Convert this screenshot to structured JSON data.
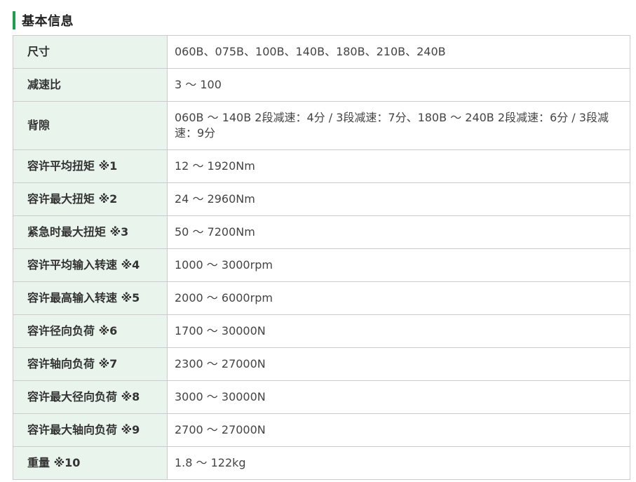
{
  "section": {
    "title": "基本信息",
    "accent_color": "#1f9e4f",
    "label_bg_color": "#e9f4ec"
  },
  "specs": [
    {
      "label": "尺寸",
      "value": "060B、075B、100B、140B、180B、210B、240B"
    },
    {
      "label": "减速比",
      "value": "3 ～ 100"
    },
    {
      "label": "背隙",
      "value": "060B ～ 140B 2段减速：4分 / 3段减速：7分、180B ～ 240B 2段减速：6分 / 3段减速：9分"
    },
    {
      "label": "容许平均扭矩 ※1",
      "value": "12 ～ 1920Nm"
    },
    {
      "label": "容许最大扭矩 ※2",
      "value": "24 ～ 2960Nm"
    },
    {
      "label": "紧急时最大扭矩 ※3",
      "value": "50 ～ 7200Nm"
    },
    {
      "label": "容许平均输入转速 ※4",
      "value": "1000 ～ 3000rpm"
    },
    {
      "label": "容许最高输入转速 ※5",
      "value": "2000 ～ 6000rpm"
    },
    {
      "label": "容许径向负荷 ※6",
      "value": "1700 ～ 30000N"
    },
    {
      "label": "容许轴向负荷 ※7",
      "value": "2300 ～ 27000N"
    },
    {
      "label": "容许最大径向负荷 ※8",
      "value": "3000 ～ 30000N"
    },
    {
      "label": "容许最大轴向负荷 ※9",
      "value": "2700 ～ 27000N"
    },
    {
      "label": "重量 ※10",
      "value": "1.8 ～ 122kg"
    }
  ]
}
